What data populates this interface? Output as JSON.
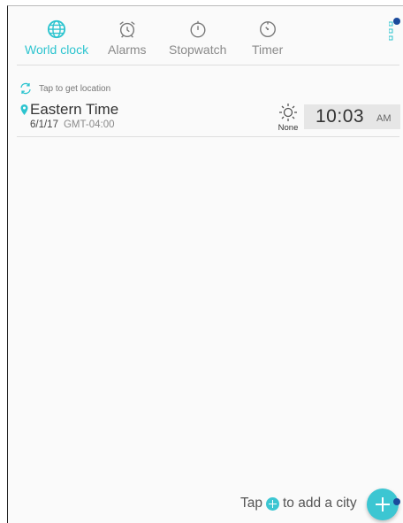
{
  "tabs": [
    {
      "label": "World clock",
      "icon": "globe-icon",
      "active": true
    },
    {
      "label": "Alarms",
      "icon": "alarm-clock-icon",
      "active": false
    },
    {
      "label": "Stopwatch",
      "icon": "stopwatch-icon",
      "active": false
    },
    {
      "label": "Timer",
      "icon": "timer-icon",
      "active": false
    }
  ],
  "location": {
    "label": "Tap to get location",
    "icon": "refresh-icon"
  },
  "city": {
    "name": "Eastern Time",
    "date": "6/1/17",
    "gmt": "GMT-04:00",
    "weather_icon": "sun-icon",
    "weather_label": "None",
    "time": "10:03",
    "ampm": "AM"
  },
  "hint": {
    "before": "Tap",
    "after": "to add a city"
  },
  "colors": {
    "accent": "#2cc4cf",
    "fab": "#3cc6d2",
    "marker": "#1a4a9c",
    "time_bg": "#e6e6e6"
  }
}
